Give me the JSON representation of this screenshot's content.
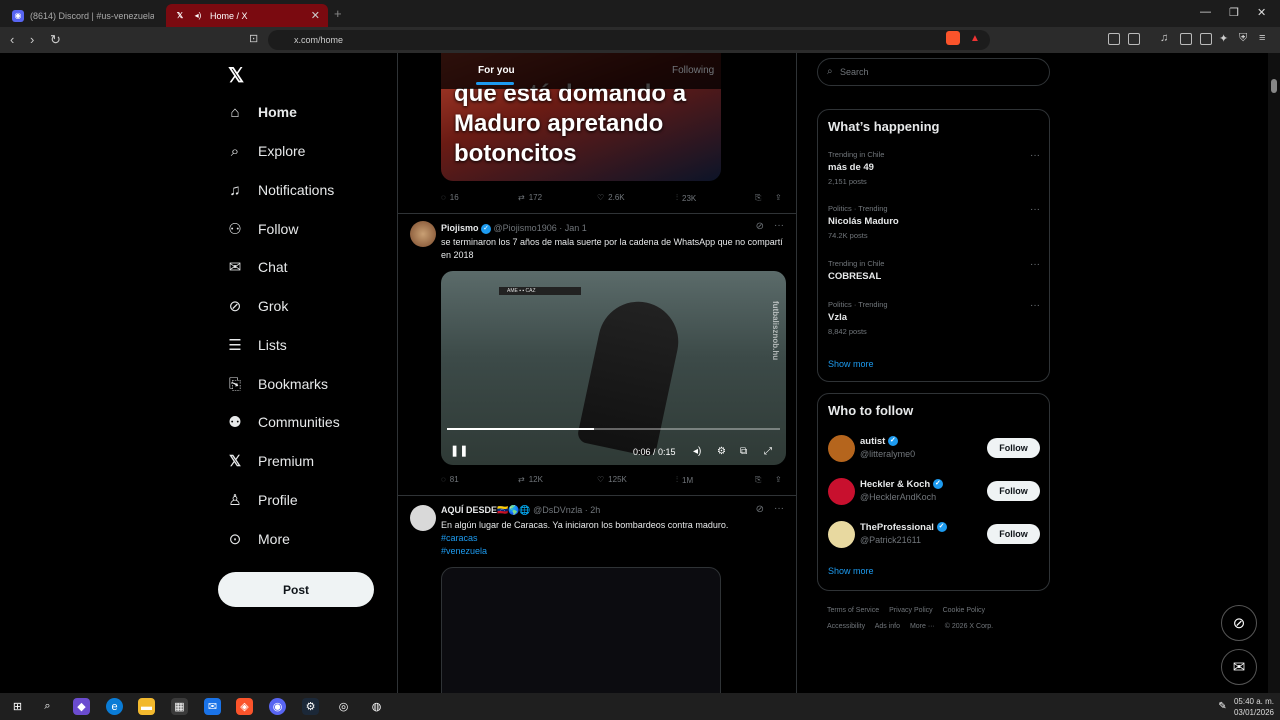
{
  "browser": {
    "tabs": [
      {
        "title": "(8614) Discord | #us-venezuela-disc..."
      },
      {
        "title": "Home / X"
      }
    ],
    "url": "x.com/home"
  },
  "nav": {
    "items": [
      {
        "label": "Home",
        "icon": "home-icon"
      },
      {
        "label": "Explore",
        "icon": "search-icon"
      },
      {
        "label": "Notifications",
        "icon": "bell-icon"
      },
      {
        "label": "Follow",
        "icon": "person-add-icon"
      },
      {
        "label": "Chat",
        "icon": "mail-icon"
      },
      {
        "label": "Grok",
        "icon": "grok-icon"
      },
      {
        "label": "Lists",
        "icon": "list-icon"
      },
      {
        "label": "Bookmarks",
        "icon": "bookmark-icon"
      },
      {
        "label": "Communities",
        "icon": "people-icon"
      },
      {
        "label": "Premium",
        "icon": "x-icon"
      },
      {
        "label": "Profile",
        "icon": "person-icon"
      },
      {
        "label": "More",
        "icon": "more-circle-icon"
      }
    ],
    "post_label": "Post"
  },
  "feed": {
    "tabs": {
      "for_you": "For you",
      "following": "Following"
    },
    "tweet0": {
      "image_caption": [
        "que está domando a",
        "Maduro apretando",
        "botoncitos"
      ],
      "replies": "16",
      "reposts": "172",
      "likes": "2.6K",
      "views": "23K"
    },
    "tweet1": {
      "name": "Piojismo",
      "handle": "@Piojismo1906 · Jan 1",
      "text": "se terminaron los 7 años de mala suerte por la cadena de WhatsApp que no compartí en 2018",
      "video_time": "0:06 / 0:15",
      "video_progress": 0.44,
      "watermark": "futbalisznob.hu",
      "replies": "81",
      "reposts": "12K",
      "likes": "125K",
      "views": "1M"
    },
    "tweet2": {
      "name": "AQUÍ DESDE🇻🇪🌎🌐",
      "handle": "@DsDVnzla · 2h",
      "text": "En algún lugar de Caracas. Ya iniciaron los bombardeos contra maduro.",
      "hashtags": [
        "#caracas",
        "#venezuela"
      ]
    }
  },
  "sidebar": {
    "search_placeholder": "Search",
    "happening_title": "What’s happening",
    "trends": [
      {
        "context": "Trending in Chile",
        "topic": "más de 49",
        "count": "2,151 posts"
      },
      {
        "context": "Politics · Trending",
        "topic": "Nicolás Maduro",
        "count": "74.2K posts"
      },
      {
        "context": "Trending in Chile",
        "topic": "COBRESAL",
        "count": ""
      },
      {
        "context": "Politics · Trending",
        "topic": "Vzla",
        "count": "8,842 posts"
      }
    ],
    "show_more": "Show more",
    "wtf_title": "Who to follow",
    "who_to_follow": [
      {
        "name": "autist",
        "handle": "@litteralyme0",
        "avatar_color": "#b5651d"
      },
      {
        "name": "Heckler & Koch",
        "handle": "@HecklerAndKoch",
        "avatar_color": "#c8102e"
      },
      {
        "name": "TheProfessional",
        "handle": "@Patrick21611",
        "avatar_color": "#e8d9a0"
      }
    ],
    "follow_label": "Follow",
    "footer": [
      "Terms of Service",
      "Privacy Policy",
      "Cookie Policy",
      "Accessibility",
      "Ads info",
      "More ···",
      "© 2026 X Corp."
    ]
  },
  "taskbar": {
    "time": "05:40 a. m.",
    "date": "03/01/2026"
  },
  "colors": {
    "accent": "#1d9bf0",
    "background": "#000000",
    "active_tab": "#7a0a10"
  }
}
